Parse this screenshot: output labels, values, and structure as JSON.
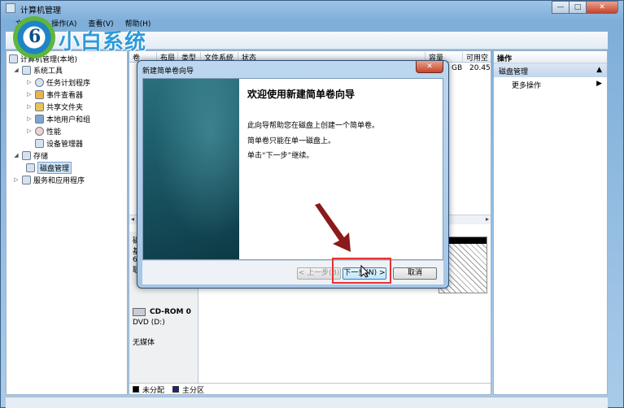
{
  "window": {
    "title": "计算机管理",
    "minimize_glyph": "—",
    "maximize_glyph": "□",
    "close_glyph": "✕"
  },
  "menu": [
    "文件(F)",
    "操作(A)",
    "查看(V)",
    "帮助(H)"
  ],
  "logo": {
    "digit": "6",
    "brand": "小白系统"
  },
  "tree": {
    "root": "计算机管理(本地)",
    "system_tools": "系统工具",
    "task_scheduler": "任务计划程序",
    "event_viewer": "事件查看器",
    "shared_folders": "共享文件夹",
    "local_users": "本地用户和组",
    "performance": "性能",
    "device_manager": "设备管理器",
    "storage": "存储",
    "disk_management": "磁盘管理",
    "services_apps": "服务和应用程序"
  },
  "volume_table": {
    "headers": [
      "卷",
      "布局",
      "类型",
      "文件系统",
      "状态",
      "容量",
      "可用空"
    ],
    "row_capacity": "GB",
    "row_free": "20.45"
  },
  "disks": {
    "letters": [
      "磁",
      "基",
      "6",
      "联"
    ],
    "cdrom_name": "CD-ROM 0",
    "cdrom_drive": "DVD (D:)",
    "cdrom_media": "无媒体"
  },
  "legend": [
    {
      "label": "未分配",
      "color": "#000000"
    },
    {
      "label": "主分区",
      "color": "#1a237e"
    }
  ],
  "actions": {
    "header": "操作",
    "section": "磁盘管理",
    "more": "更多操作"
  },
  "wizard": {
    "title": "新建简单卷向导",
    "close_glyph": "✕",
    "heading": "欢迎使用新建简单卷向导",
    "line1": "此向导帮助您在磁盘上创建一个简单卷。",
    "line2": "简单卷只能在单一磁盘上。",
    "line3": "单击“下一步”继续。",
    "back_label": "< 上一步(B)",
    "next_label": "下一步(N) >",
    "cancel_label": "取消"
  },
  "colors": {
    "highlight": "#e53333",
    "arrow": "#8b1a1a",
    "banner": "#1d5c6a"
  }
}
